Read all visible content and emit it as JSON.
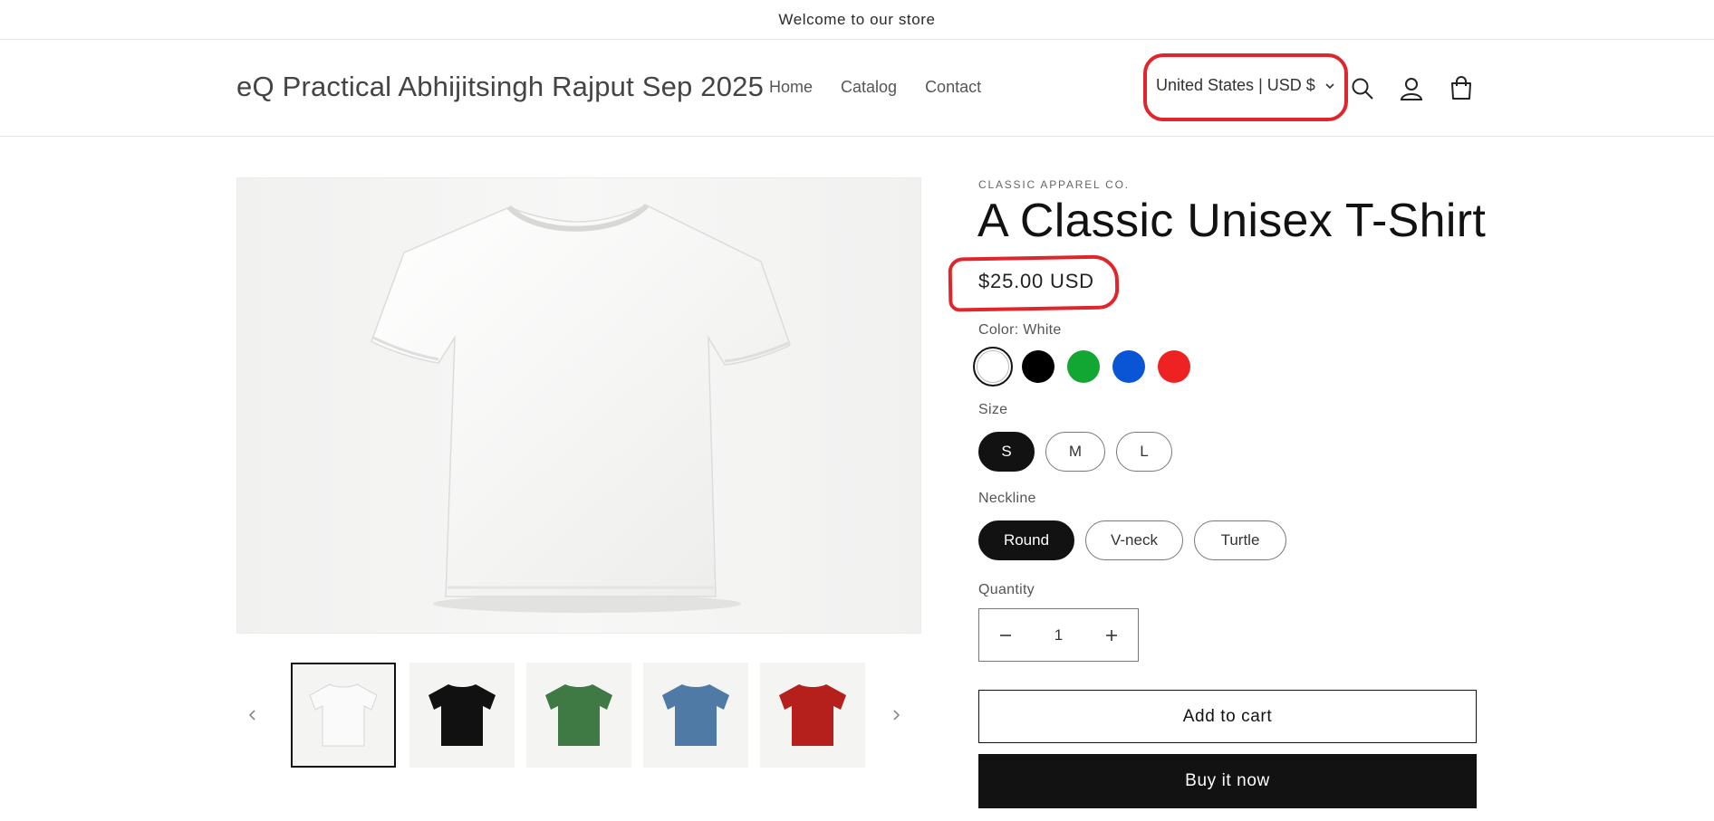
{
  "announcement": {
    "text": "Welcome to our store"
  },
  "header": {
    "store_title": "eQ Practical Abhijitsingh Rajput Sep 2025",
    "nav": [
      {
        "label": "Home"
      },
      {
        "label": "Catalog"
      },
      {
        "label": "Contact"
      }
    ],
    "locale_label": "United States | USD $",
    "icons": [
      "search-icon",
      "account-icon",
      "cart-icon"
    ]
  },
  "annotation_color": "#e0262b",
  "product": {
    "vendor": "CLASSIC APPAREL CO.",
    "title": "A Classic Unisex T-Shirt",
    "price": "$25.00 USD",
    "color_label": "Color: White",
    "colors": [
      {
        "name": "White",
        "hex": "#ffffff",
        "selected": true
      },
      {
        "name": "Black",
        "hex": "#000000",
        "selected": false
      },
      {
        "name": "Green",
        "hex": "#12a633",
        "selected": false
      },
      {
        "name": "Blue",
        "hex": "#0a55d6",
        "selected": false
      },
      {
        "name": "Red",
        "hex": "#ee2222",
        "selected": false
      }
    ],
    "size_label": "Size",
    "sizes": [
      {
        "label": "S",
        "selected": true
      },
      {
        "label": "M",
        "selected": false
      },
      {
        "label": "L",
        "selected": false
      }
    ],
    "neckline_label": "Neckline",
    "necklines": [
      {
        "label": "Round",
        "selected": true
      },
      {
        "label": "V-neck",
        "selected": false
      },
      {
        "label": "Turtle",
        "selected": false
      }
    ],
    "quantity_label": "Quantity",
    "quantity": "1",
    "add_to_cart": "Add to cart",
    "buy_now": "Buy it now"
  },
  "gallery": {
    "main_color": "#ffffff",
    "thumbnails": [
      {
        "color": "#ffffff",
        "active": true
      },
      {
        "color": "#111111",
        "active": false
      },
      {
        "color": "#3f7a45",
        "active": false
      },
      {
        "color": "#4f7aa6",
        "active": false
      },
      {
        "color": "#b5201c",
        "active": false
      }
    ]
  }
}
